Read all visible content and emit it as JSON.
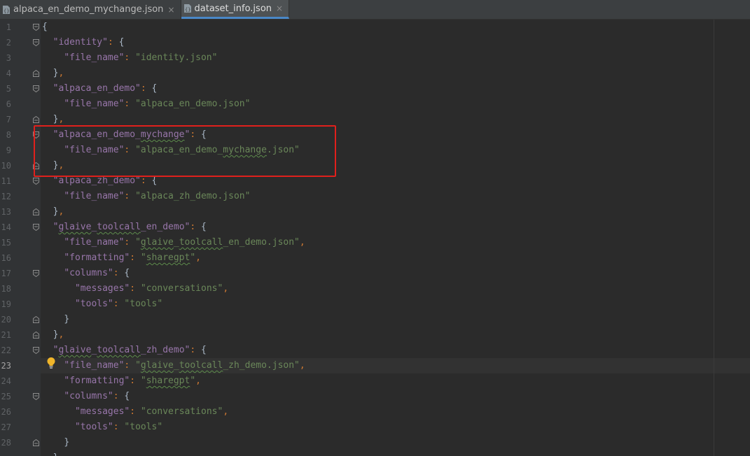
{
  "tabs": [
    {
      "label": "alpaca_en_demo_mychange.json",
      "close": "×",
      "active": false
    },
    {
      "label": "dataset_info.json",
      "close": "×",
      "active": true
    }
  ],
  "current_line": 23,
  "lines": [
    {
      "n": "1"
    },
    {
      "n": "2"
    },
    {
      "n": "3"
    },
    {
      "n": "4"
    },
    {
      "n": "5"
    },
    {
      "n": "6"
    },
    {
      "n": "7"
    },
    {
      "n": "8"
    },
    {
      "n": "9"
    },
    {
      "n": "10"
    },
    {
      "n": "11"
    },
    {
      "n": "12"
    },
    {
      "n": "13"
    },
    {
      "n": "14"
    },
    {
      "n": "15"
    },
    {
      "n": "16"
    },
    {
      "n": "17"
    },
    {
      "n": "18"
    },
    {
      "n": "19"
    },
    {
      "n": "20"
    },
    {
      "n": "21"
    },
    {
      "n": "22"
    },
    {
      "n": "23"
    },
    {
      "n": "24"
    },
    {
      "n": "25"
    },
    {
      "n": "26"
    },
    {
      "n": "27"
    },
    {
      "n": "28"
    }
  ],
  "code": {
    "l1": "{",
    "l2_key": "\"identity\"",
    "l3_key": "\"file_name\"",
    "l3_val": "\"identity.json\"",
    "l5_key": "\"alpaca_en_demo\"",
    "l6_key": "\"file_name\"",
    "l6_val": "\"alpaca_en_demo.json\"",
    "l8_key_a": "\"alpaca_en_demo_",
    "l8_key_b": "mychange",
    "l8_key_c": "\"",
    "l9_key": "\"file_name\"",
    "l9_val_a": "\"alpaca_en_demo_",
    "l9_val_b": "mychange",
    "l9_val_c": ".json\"",
    "l11_key": "\"alpaca_zh_demo\"",
    "l12_key": "\"file_name\"",
    "l12_val": "\"alpaca_zh_demo.json\"",
    "l14_key_a": "\"",
    "l14_key_b": "glaive",
    "l14_key_c": "_",
    "l14_key_d": "toolcall",
    "l14_key_e": "_en_demo\"",
    "l15_key": "\"file_name\"",
    "l15_val_a": "\"",
    "l15_val_b": "glaive",
    "l15_val_c": "_",
    "l15_val_d": "toolcall",
    "l15_val_e": "_en_demo.json\"",
    "l16_key": "\"formatting\"",
    "l16_val_a": "\"",
    "l16_val_b": "sharegpt",
    "l16_val_c": "\"",
    "l17_key": "\"columns\"",
    "l18_key": "\"messages\"",
    "l18_val": "\"conversations\"",
    "l19_key": "\"tools\"",
    "l19_val": "\"tools\"",
    "l22_key_a": "\"",
    "l22_key_b": "glaive",
    "l22_key_c": "_",
    "l22_key_d": "toolcall",
    "l22_key_e": "_zh_demo\"",
    "l23_key": "\"file_name\"",
    "l23_val_a": "\"",
    "l23_val_b": "glaive",
    "l23_val_c": "_",
    "l23_val_d": "toolcall",
    "l23_val_e": "_zh_demo.json\"",
    "l24_key": "\"formatting\"",
    "l24_val_a": "\"",
    "l24_val_b": "sharegpt",
    "l24_val_c": "\"",
    "l25_key": "\"columns\"",
    "l26_key": "\"messages\"",
    "l26_val": "\"conversations\"",
    "l27_key": "\"tools\"",
    "l27_val": "\"tools\""
  },
  "colors": {
    "background": "#2b2b2b",
    "key": "#9876aa",
    "string": "#6a8759",
    "punctuation": "#cc7832",
    "highlight_box": "#e0201c"
  }
}
